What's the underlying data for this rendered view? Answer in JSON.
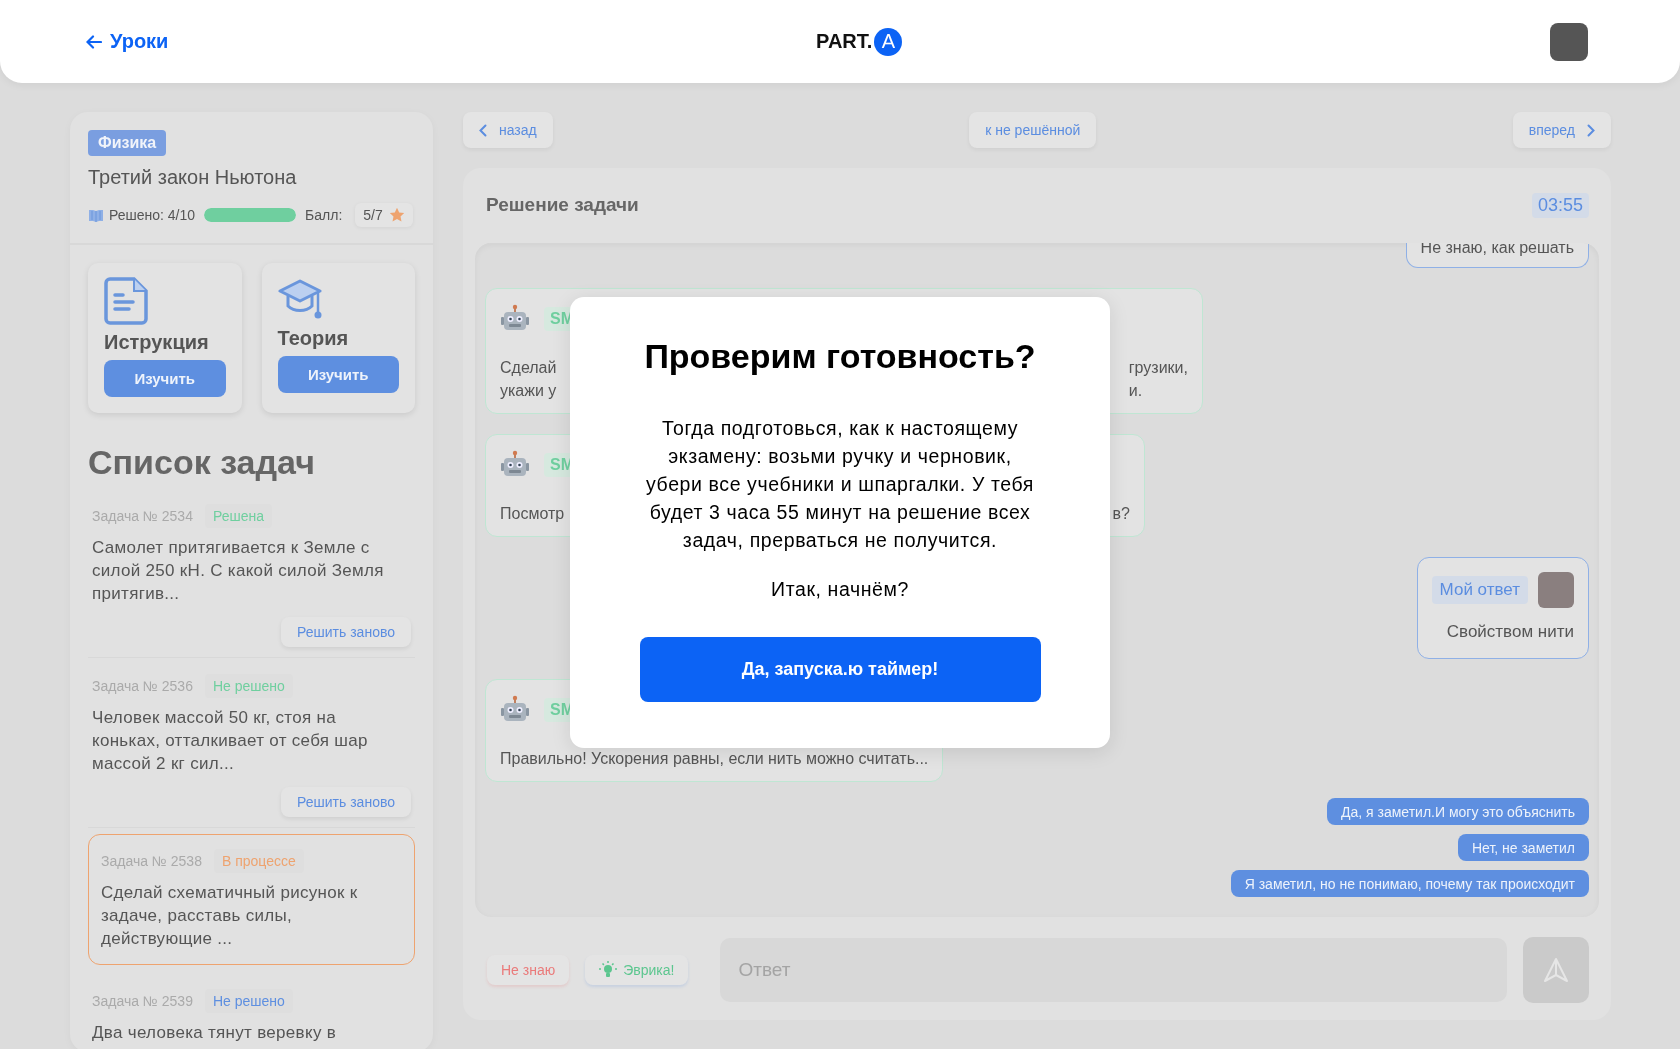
{
  "header": {
    "back_link": "Уроки",
    "logo_text": "PART.",
    "logo_badge": "A"
  },
  "lesson": {
    "subject": "Физика",
    "title": "Третий закон Ньютона",
    "solved_label": "Решено: 4/10",
    "progress": {
      "level": 1
    },
    "score_label": "Балл:",
    "score": "5/7"
  },
  "resources": [
    {
      "kind": "instruction",
      "title": "Иструкция",
      "button": "Изучить"
    },
    {
      "kind": "theory",
      "title": "Теория",
      "button": "Изучить"
    }
  ],
  "task_list": {
    "title": "Список задач",
    "tasks": [
      {
        "number": "Задача № 2534",
        "status": "Решена",
        "color": "#6fcf9f",
        "text": "Самолет притягивается к Земле с силой 250 кН. С какой силой Земля притягив...",
        "button": "Решить заново",
        "selected": false
      },
      {
        "number": "Задача № 2536",
        "status": "Не решено",
        "color": "#6fcf9f",
        "text": "Человек массой 50 кг, стоя на коньках, отталкивает от себя шар массой 2 кг сил...",
        "button": "Решить заново",
        "selected": false
      },
      {
        "number": "Задача № 2538",
        "status": "В процессе",
        "color": "#eea36f",
        "text": "Сделай схематичный рисунок к задаче, расставь силы, действующие ...",
        "selected": true
      },
      {
        "number": "Задача № 2539",
        "status": "Не решено",
        "color": "#5e8fe0",
        "text": "Два человека тянут веревку в",
        "selected": false
      }
    ]
  },
  "nav": {
    "back": "назад",
    "unsolved": "к не решённой",
    "forward": "вперед"
  },
  "solution": {
    "title": "Решение задачи",
    "timer": "03:55",
    "messages": [
      {
        "kind": "user",
        "text": "Не знаю, как решать"
      },
      {
        "kind": "bot",
        "name": "SM",
        "left": [
          "Сделай",
          "укажи у"
        ],
        "right": [
          "грузики,",
          "и."
        ]
      },
      {
        "kind": "bot",
        "name": "SM",
        "left": [
          "Посмотр"
        ],
        "right": [
          "в?"
        ]
      },
      {
        "kind": "answer",
        "label": "Мой ответ",
        "text": "Свойством нити"
      },
      {
        "kind": "bot",
        "name": "SM",
        "left": [
          "Правильно! Ускорения равны, если нить можно считать..."
        ]
      },
      {
        "kind": "option",
        "text": "Да, я заметил.И могу это объяснить"
      },
      {
        "kind": "option",
        "text": "Нет, не заметил"
      },
      {
        "kind": "option",
        "text": "Я заметил, но не понимаю, почему так происходит"
      }
    ],
    "dont_know": "Не знаю",
    "eureka": "Эврика!",
    "answer_placeholder": "Ответ"
  },
  "modal": {
    "title": "Проверим готовность?",
    "body": "Тогда подготовься, как к настоящему экзамену: возьми ручку и черновик, убери все учебники и шпаргалки. У тебя будет 3 часа 55 минут на решение всех задач, прерваться не получится.",
    "question": "Итак, начнём?",
    "button": "Да, запуска.ю таймер!"
  }
}
